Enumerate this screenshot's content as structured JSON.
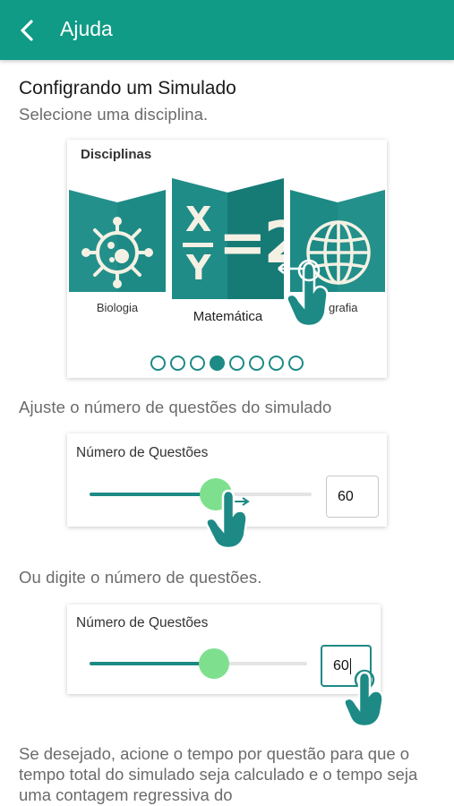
{
  "appbar": {
    "title": "Ajuda"
  },
  "section": {
    "title": "Configrando um Simulado",
    "step1": "Selecione uma disciplina.",
    "step2": "Ajuste o número de questões do simulado",
    "step3": "Ou digite o número de questões.",
    "step4": "Se desejado, acione o tempo por questão para que o tempo total do simulado seja calculado e o tempo seja uma contagem regressiva do"
  },
  "disciplines_card": {
    "label": "Disciplinas",
    "subjects": [
      {
        "name": "Biologia",
        "icon": "virus-icon"
      },
      {
        "name": "Matemática",
        "icon": "math-fraction-icon",
        "formula_top": "X",
        "formula_bottom": "Y",
        "formula_right": "=2"
      },
      {
        "name": "grafia",
        "icon": "globe-icon"
      }
    ],
    "page_dots": {
      "count": 8,
      "active_index": 3
    }
  },
  "slider_card_1": {
    "label": "Número de Questões",
    "value": "60",
    "fill_fraction": 0.57
  },
  "slider_card_2": {
    "label": "Número de Questões",
    "value": "60",
    "fill_fraction": 0.57
  },
  "colors": {
    "appbar": "#0f9b86",
    "accent": "#1d8a85",
    "thumb": "#7ee08e",
    "subject_bg": "#1d8a85"
  }
}
